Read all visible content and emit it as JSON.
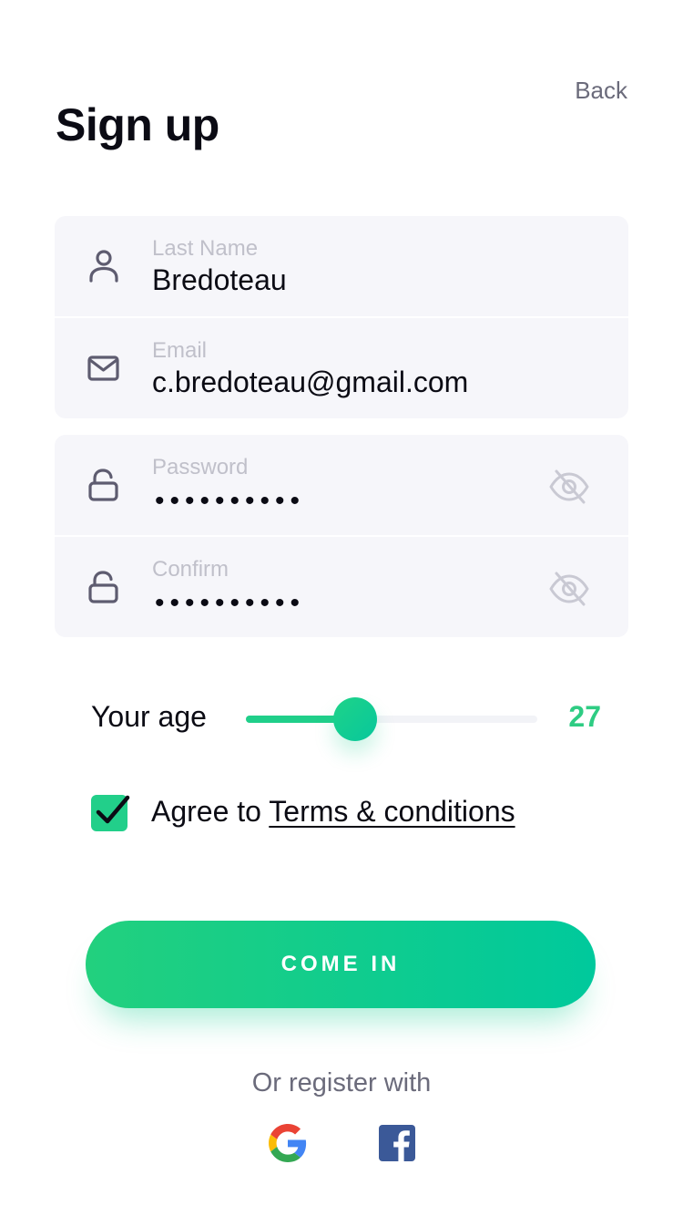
{
  "header": {
    "back_label": "Back",
    "title": "Sign up"
  },
  "form": {
    "last_name": {
      "label": "Last Name",
      "value": "Bredoteau",
      "icon": "user-icon"
    },
    "email": {
      "label": "Email",
      "value": "c.bredoteau@gmail.com",
      "icon": "mail-icon"
    },
    "password": {
      "label": "Password",
      "masked_value": "••••••••••",
      "icon": "lock-icon",
      "toggle_icon": "eye-off-icon"
    },
    "confirm": {
      "label": "Confirm",
      "masked_value": "••••••••••",
      "icon": "lock-icon",
      "toggle_icon": "eye-off-icon"
    }
  },
  "age": {
    "label": "Your age",
    "value": "27",
    "slider_fraction": 0.375
  },
  "terms": {
    "checked": true,
    "prefix": "Agree to ",
    "link_label": "Terms & conditions"
  },
  "submit": {
    "label": "COME IN"
  },
  "social": {
    "label": "Or register with",
    "providers": [
      "google-icon",
      "facebook-icon"
    ]
  },
  "colors": {
    "accent": "#22cf8a",
    "accent_end": "#00c99c",
    "age_value": "#2ecc83",
    "field_bg": "#f6f6fa",
    "label_gray": "#c0c0ca",
    "icon_gray": "#5e5c70",
    "facebook": "#3b5998"
  }
}
